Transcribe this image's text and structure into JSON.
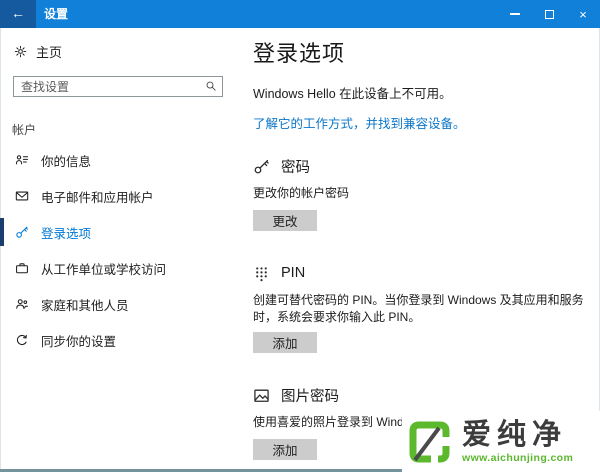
{
  "titlebar": {
    "back_glyph": "←",
    "title": "设置",
    "close_glyph": "×"
  },
  "sidebar": {
    "home_label": "主页",
    "search_placeholder": "查找设置",
    "section_label": "帐户",
    "items": [
      {
        "label": "你的信息",
        "icon": "contact-card-icon",
        "selected": false
      },
      {
        "label": "电子邮件和应用帐户",
        "icon": "email-icon",
        "selected": false
      },
      {
        "label": "登录选项",
        "icon": "key-icon",
        "selected": true
      },
      {
        "label": "从工作单位或学校访问",
        "icon": "briefcase-icon",
        "selected": false
      },
      {
        "label": "家庭和其他人员",
        "icon": "people-icon",
        "selected": false
      },
      {
        "label": "同步你的设置",
        "icon": "sync-icon",
        "selected": false
      }
    ]
  },
  "main": {
    "title": "登录选项",
    "hello_status": "Windows Hello 在此设备上不可用。",
    "hello_link": "了解它的工作方式，并找到兼容设备。",
    "sections": [
      {
        "icon": "key-icon",
        "title": "密码",
        "desc": "更改你的帐户密码",
        "button": "更改"
      },
      {
        "icon": "pin-pad-icon",
        "title": "PIN",
        "desc": "创建可替代密码的 PIN。当你登录到 Windows 及其应用和服务时，系统会要求你输入此 PIN。",
        "button": "添加"
      },
      {
        "icon": "picture-icon",
        "title": "图片密码",
        "desc": "使用喜爱的照片登录到 Windows",
        "button": "添加"
      }
    ]
  },
  "watermark": {
    "brand": "爱纯净",
    "url": "www.aichunjing.com"
  },
  "colors": {
    "titlebar": "#1080d8",
    "back_button": "#15599e",
    "accent": "#0078d7",
    "selected_bar": "#1b3e6f",
    "link": "#0b76c9",
    "button_bg": "#cccccc",
    "watermark_green": "#5cb82d",
    "bottom_border": "#74949d"
  }
}
